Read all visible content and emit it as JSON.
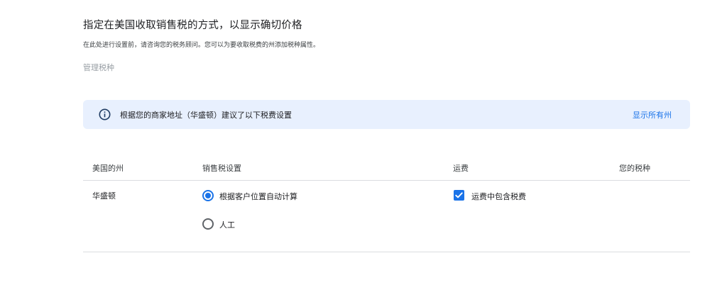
{
  "header": {
    "title": "指定在美国收取销售税的方式，以显示确切价格",
    "subtitle": "在此处进行设置前，请咨询您的税务顾问。您可以为要收取税费的州添加税种属性。",
    "manage_link": "管理税种"
  },
  "banner": {
    "icon": "info-icon",
    "text": "根据您的商家地址（华盛顿）建议了以下税费设置",
    "action": "显示所有州"
  },
  "table": {
    "columns": [
      "美国的州",
      "销售税设置",
      "运费",
      "您的税种"
    ],
    "rows": [
      {
        "state": "华盛顿",
        "sales_tax_options": [
          {
            "label": "根据客户位置自动计算",
            "selected": true
          },
          {
            "label": "人工",
            "selected": false
          }
        ],
        "shipping": {
          "label": "运费中包含税费",
          "checked": true
        },
        "tax_type": ""
      }
    ]
  },
  "colors": {
    "accent": "#1a73e8",
    "banner_bg": "#e8f0fe",
    "muted_text": "#9aa0a6",
    "divider": "#dadce0"
  }
}
